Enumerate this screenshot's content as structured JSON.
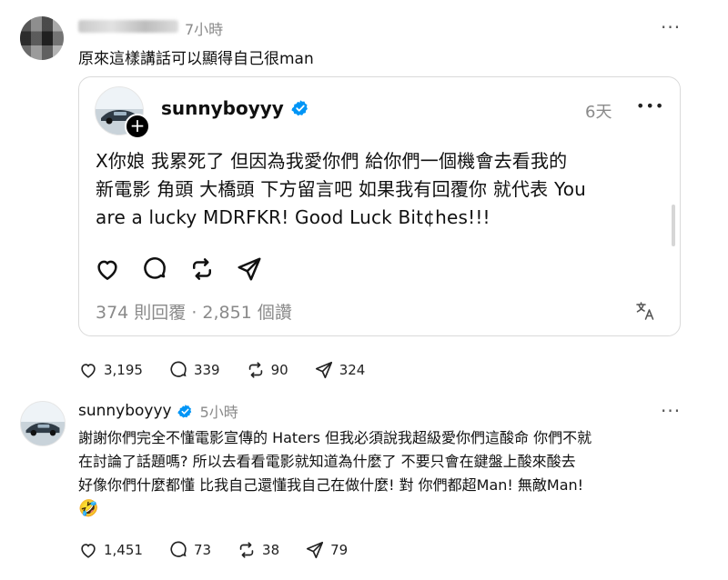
{
  "comment": {
    "time": "7小時",
    "text": "原來這樣講話可以顯得自己很man",
    "more": "···",
    "stats": {
      "likes": "3,195",
      "replies": "339",
      "reposts": "90",
      "shares": "324"
    }
  },
  "quoted_post": {
    "username": "sunnyboyyy",
    "time": "6天",
    "more": "•••",
    "lines": [
      "X你娘 我累死了 但因為我愛你們 給你們一個機會去看我的",
      "新電影 角頭 大橋頭 下方留言吧 如果我有回覆你 就代表 You",
      "are a lucky MDRFKR! Good Luck Bit¢hes!!!"
    ],
    "footer": "374 則回覆 · 2,851 個讚",
    "translate_icon": "translate-icon"
  },
  "reply": {
    "username": "sunnyboyyy",
    "time": "5小時",
    "more": "···",
    "lines": [
      "謝謝你們完全不懂電影宣傳的 Haters 但我必須說我超級愛你們這酸命 你們不就",
      "在討論了話題嗎? 所以去看看電影就知道為什麼了 不要只會在鍵盤上酸來酸去",
      "好像你們什麼都懂 比我自己還懂我自己在做什麼! 對 你們都超Man! 無敵Man!"
    ],
    "emoji": "🤣",
    "stats": {
      "likes": "1,451",
      "replies": "73",
      "reposts": "38",
      "shares": "79"
    }
  },
  "colors": {
    "verified": "#0095f6",
    "muted": "#8a8a8a",
    "border": "#dadada"
  }
}
